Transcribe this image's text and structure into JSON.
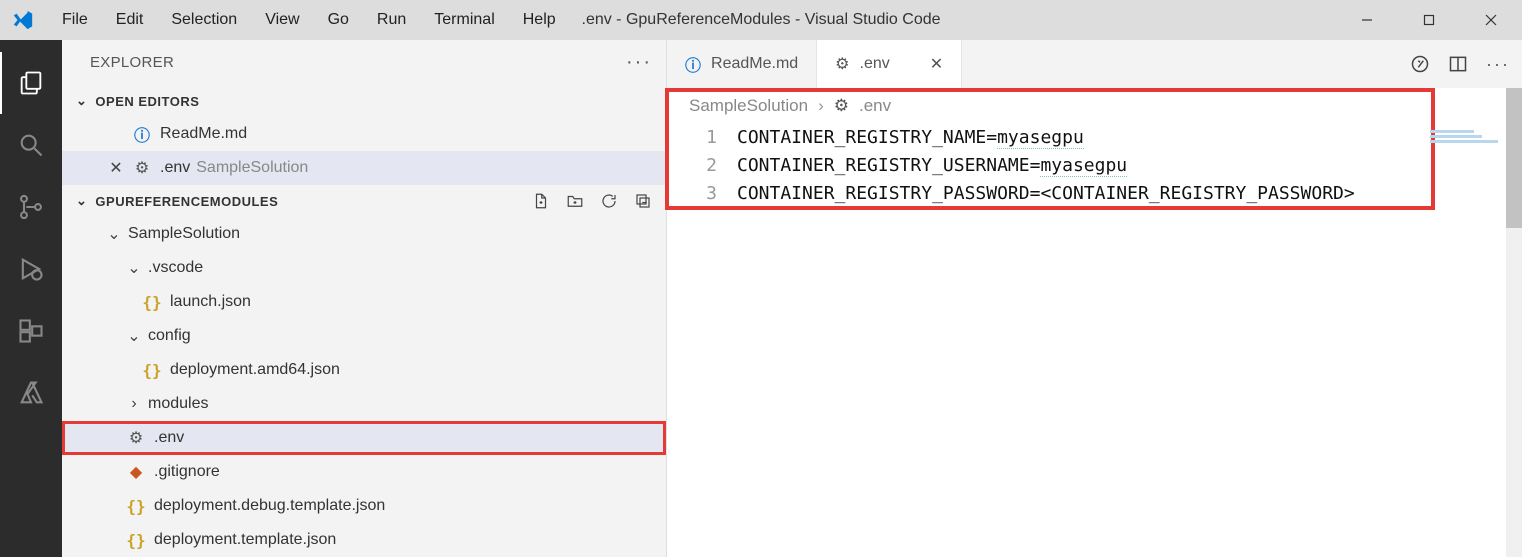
{
  "titlebar": {
    "menu": [
      "File",
      "Edit",
      "Selection",
      "View",
      "Go",
      "Run",
      "Terminal",
      "Help"
    ],
    "title": ".env - GpuReferenceModules - Visual Studio Code"
  },
  "sidebar": {
    "title": "EXPLORER",
    "sections": {
      "open_editors": "OPEN EDITORS",
      "project": "GPUREFERENCEMODULES"
    }
  },
  "open_editors": [
    {
      "name": "ReadMe.md",
      "icon": "info"
    },
    {
      "name": ".env",
      "suffix": "SampleSolution",
      "icon": "gear",
      "active": true,
      "closeable": true
    }
  ],
  "tree": {
    "root": "SampleSolution",
    "vscode": ".vscode",
    "launch": "launch.json",
    "config": "config",
    "deploy_amd": "deployment.amd64.json",
    "modules": "modules",
    "env": ".env",
    "gitignore": ".gitignore",
    "dbg_tpl": "deployment.debug.template.json",
    "tpl": "deployment.template.json"
  },
  "tabs": [
    {
      "name": "ReadMe.md",
      "icon": "info"
    },
    {
      "name": ".env",
      "icon": "gear",
      "active": true,
      "closeable": true
    }
  ],
  "breadcrumb": {
    "folder": "SampleSolution",
    "file": ".env"
  },
  "code": {
    "lines": [
      {
        "n": "1",
        "key": "CONTAINER_REGISTRY_NAME=",
        "val": "myasegpu"
      },
      {
        "n": "2",
        "key": "CONTAINER_REGISTRY_USERNAME=",
        "val": "myasegpu"
      },
      {
        "n": "3",
        "key": "CONTAINER_REGISTRY_PASSWORD=",
        "val": "<CONTAINER_REGISTRY_PASSWORD>"
      }
    ]
  }
}
